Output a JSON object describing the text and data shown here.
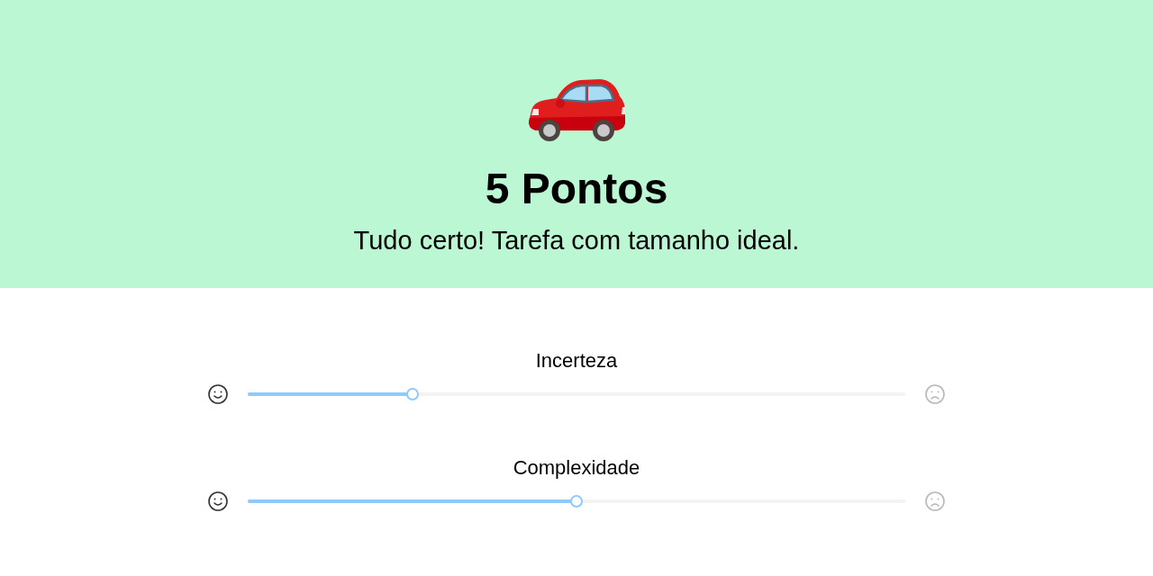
{
  "header": {
    "title": "5 Pontos",
    "message": "Tudo certo! Tarefa com tamanho ideal."
  },
  "sliders": [
    {
      "label": "Incerteza",
      "level": 0.25
    },
    {
      "label": "Complexidade",
      "level": 0.5
    }
  ]
}
